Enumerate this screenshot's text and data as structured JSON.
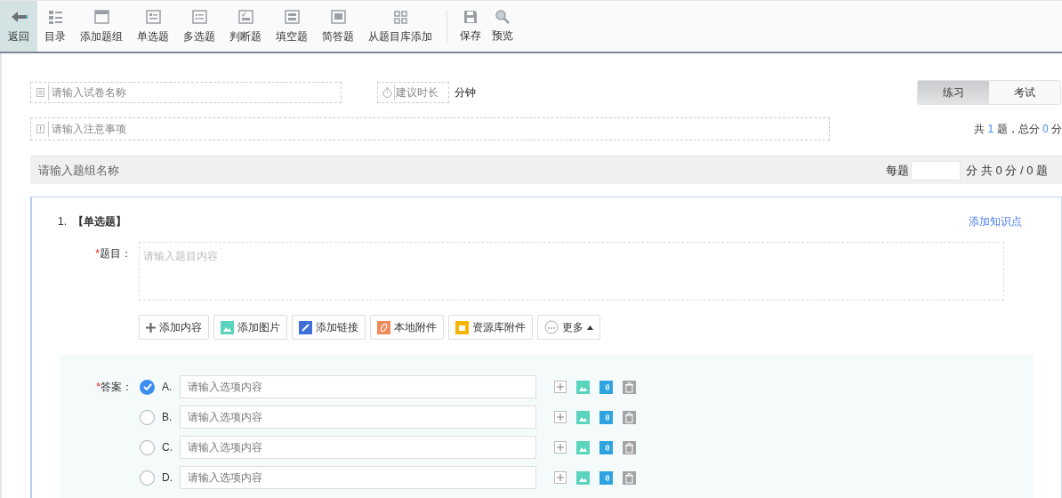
{
  "toolbar": {
    "items": [
      {
        "label": "返回",
        "selected": true
      },
      {
        "label": "目录",
        "selected": false
      },
      {
        "label": "添加题组",
        "selected": false
      },
      {
        "label": "单选题",
        "selected": false
      },
      {
        "label": "多选题",
        "selected": false
      },
      {
        "label": "判断题",
        "selected": false
      },
      {
        "label": "填空题",
        "selected": false
      },
      {
        "label": "简答题",
        "selected": false
      },
      {
        "label": "从题目库添加",
        "selected": false
      }
    ],
    "actions": [
      {
        "label": "保存"
      },
      {
        "label": "预览"
      }
    ]
  },
  "paper": {
    "name_placeholder": "请输入试卷名称",
    "duration_placeholder": "建议时长",
    "duration_unit": "分钟",
    "mode_tabs": [
      {
        "label": "练习",
        "selected": true
      },
      {
        "label": "考试",
        "selected": false
      }
    ],
    "notes_placeholder": "请输入注意事项",
    "summary": {
      "prefix": "共",
      "count": "1",
      "middle": "题，总分",
      "score": "0",
      "suffix": "分"
    }
  },
  "group": {
    "name_placeholder": "请输入题组名称",
    "per_label": "每题",
    "totals": "分 共 0 分 / 0 题"
  },
  "question": {
    "number": "1.",
    "type": "【单选题】",
    "link": "添加知识点",
    "stem_mark": "*",
    "stem_label": "题目：",
    "stem_placeholder": "请输入题目内容",
    "tools": [
      {
        "label": "添加内容"
      },
      {
        "label": "添加图片"
      },
      {
        "label": "添加链接"
      },
      {
        "label": "本地附件"
      },
      {
        "label": "资源库附件"
      },
      {
        "label": "更多"
      }
    ],
    "answer_mark": "*",
    "answer_label": "答案：",
    "options": [
      {
        "letter": "A.",
        "placeholder": "请输入选项内容",
        "selected": true
      },
      {
        "letter": "B.",
        "placeholder": "请输入选项内容",
        "selected": false
      },
      {
        "letter": "C.",
        "placeholder": "请输入选项内容",
        "selected": false
      },
      {
        "letter": "D.",
        "placeholder": "请输入选项内容",
        "selected": false
      }
    ]
  }
}
